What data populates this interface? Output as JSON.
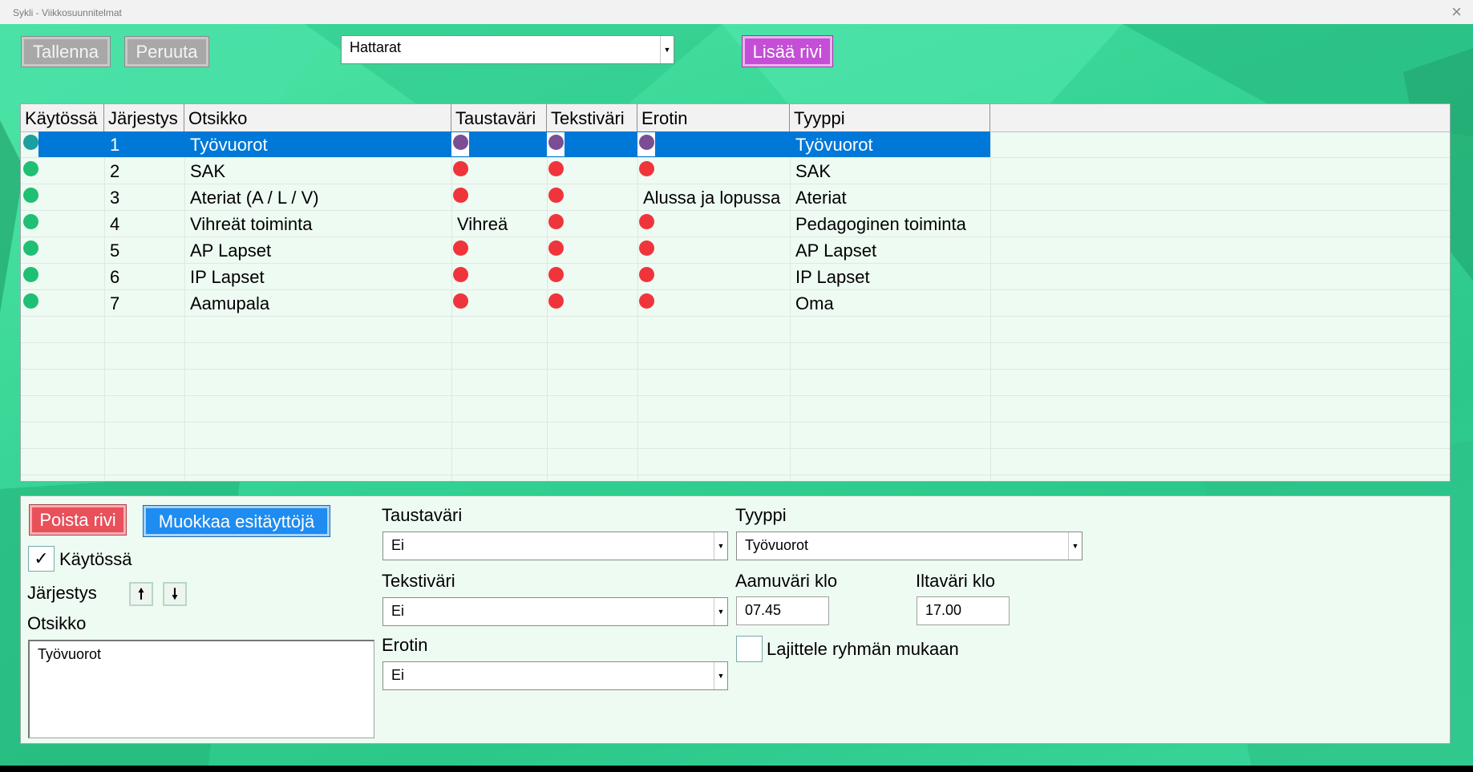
{
  "window": {
    "title": "Sykli - Viikkosuunnitelmat",
    "close_glyph": "×"
  },
  "toolbar": {
    "save_label": "Tallenna",
    "cancel_label": "Peruuta",
    "plan_select_value": "Hattarat",
    "add_row_label": "Lisää rivi"
  },
  "grid": {
    "columns": [
      "Käytössä",
      "Järjestys",
      "Otsikko",
      "Taustaväri",
      "Tekstiväri",
      "Erotin",
      "Tyyppi"
    ],
    "rows": [
      {
        "order": "1",
        "title": "Työvuorot",
        "background": "",
        "text": "",
        "separator": "",
        "type": "Työvuorot",
        "selected": true
      },
      {
        "order": "2",
        "title": "SAK",
        "background": "",
        "text": "",
        "separator": "",
        "type": "SAK",
        "selected": false
      },
      {
        "order": "3",
        "title": "Ateriat (A / L / V)",
        "background": "",
        "text": "",
        "separator": "Alussa ja lopussa",
        "type": "Ateriat",
        "selected": false
      },
      {
        "order": "4",
        "title": "Vihreät toiminta",
        "background": "Vihreä",
        "text": "",
        "separator": "",
        "type": "Pedagoginen toiminta",
        "selected": false
      },
      {
        "order": "5",
        "title": "AP Lapset",
        "background": "",
        "text": "",
        "separator": "",
        "type": "AP Lapset",
        "selected": false
      },
      {
        "order": "6",
        "title": "IP Lapset",
        "background": "",
        "text": "",
        "separator": "",
        "type": "IP Lapset",
        "selected": false
      },
      {
        "order": "7",
        "title": "Aamupala",
        "background": "",
        "text": "",
        "separator": "",
        "type": "Oma",
        "selected": false
      }
    ]
  },
  "editor": {
    "delete_row_label": "Poista rivi",
    "edit_presets_label": "Muokkaa esitäyttöjä",
    "enabled_label": "Käytössä",
    "enabled_checked": true,
    "enabled_checkmark": "✓",
    "order_label": "Järjestys",
    "move_up_glyph": "🠕",
    "move_down_glyph": "🠗",
    "title_label": "Otsikko",
    "title_value": "Työvuorot",
    "background_label": "Taustaväri",
    "background_value": "Ei",
    "text_color_label": "Tekstiväri",
    "text_color_value": "Ei",
    "separator_label": "Erotin",
    "separator_value": "Ei",
    "type_label": "Tyyppi",
    "type_value": "Työvuorot",
    "morning_color_label": "Aamuväri klo",
    "morning_color_value": "07.45",
    "evening_color_label": "Iltaväri klo",
    "evening_color_value": "17.00",
    "group_sort_label": "Lajittele ryhmän mukaan",
    "group_sort_checked": false
  },
  "colors": {
    "accent_selection": "#0078d7",
    "indicator_on": "#1fbf74",
    "indicator_red": "#f0343c",
    "indicator_selected": "#7a4d94"
  }
}
